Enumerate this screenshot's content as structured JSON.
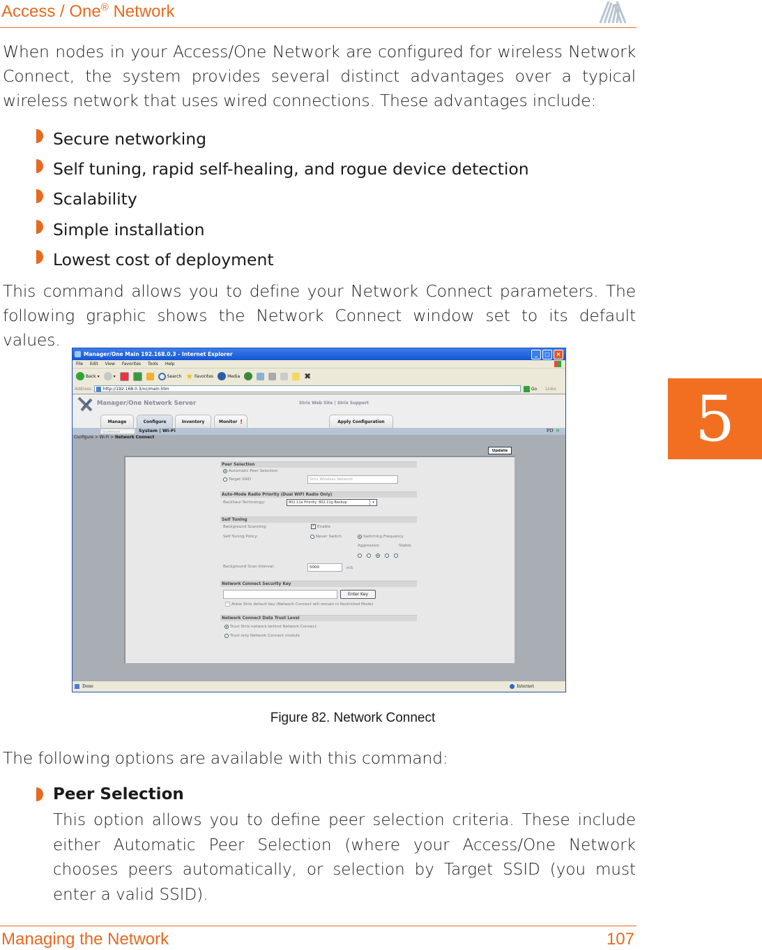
{
  "header": {
    "title": "Access / One",
    "title_sup": "®",
    "title_suffix": " Network"
  },
  "intro_paragraph": "When nodes in your Access/One Network are configured for wireless Network Connect, the system provides several distinct advantages over a typical wireless network that uses wired connections. These advantages include:",
  "advantages": [
    "Secure networking",
    "Self tuning, rapid self-healing, and rogue device detection",
    "Scalability",
    "Simple installation",
    "Lowest cost of deployment"
  ],
  "command_paragraph": "This command allows you to define your Network Connect parameters. The following graphic shows the Network Connect window set to its default values.",
  "chapter_tab": "5",
  "figure": {
    "caption": "Figure 82. Network Connect",
    "window_title": "Manager/One Main 192.168.0.3 - Internet Explorer",
    "menu": [
      "File",
      "Edit",
      "View",
      "Favorites",
      "Tools",
      "Help"
    ],
    "toolbar": {
      "back": "Back",
      "search": "Search",
      "favorites": "Favorites",
      "media": "Media"
    },
    "address_label": "Address",
    "address_url": "http://192.168.0.3/nc/main.htm",
    "go_label": "Go",
    "links_label": "Links",
    "app_title": "Manager/One Network Server",
    "header_links": "Strix Web Site  |  Strix Support",
    "tabs": [
      "Manage",
      "Configure",
      "Inventory",
      "Monitor"
    ],
    "active_tab": "Configure",
    "monitor_alert": "!",
    "apply_tab": "Apply Configuration",
    "network_select": "YourNetwork",
    "subnav": "System  |  Wi-Fi",
    "status_code": "FD",
    "breadcrumb_prefix": "Configure > Wi-Fi > ",
    "breadcrumb_current": "Network Connect",
    "update_button": "Update",
    "peer_selection": {
      "heading": "Peer Selection",
      "auto_label": "Automatic Peer Selection",
      "target_label": "Target SSID",
      "ssid_placeholder": "Strix Wireless Network",
      "selected": "Automatic Peer Selection"
    },
    "radio_priority": {
      "heading": "Auto-Mode Radio Priority (Dual WiFi Radio Only)",
      "label": "Backhaul Technology:",
      "value": "802.11a Priority, 802.11g Backup"
    },
    "self_tuning": {
      "heading": "Self Tuning",
      "scan_label": "Background Scanning:",
      "scan_enable_label": "Enable",
      "scan_enabled": true,
      "policy_label": "Self Tuning Policy:",
      "never_switch": "Never Switch",
      "switching_frequency": "Switching Frequency",
      "policy_selected": "Switching Frequency",
      "aggressive": "Aggressive",
      "stable": "Stable",
      "frequency_levels": 5,
      "frequency_selected_index": 2,
      "interval_label": "Background Scan Interval:",
      "interval_value": "5000",
      "interval_unit": "mS"
    },
    "security_key": {
      "heading": "Network Connect Security Key",
      "key_value": "",
      "enter_key_button": "Enter Key",
      "default_key_label": "Allow Strix default key (Network Connect will remain in Restricted Mode)",
      "default_key_checked": true
    },
    "trust_level": {
      "heading": "Network Connect Data Trust Level",
      "option1": "Trust Strix network behind Network Connect",
      "option2": "Trust only Network Connect module",
      "selected": "Trust Strix network behind Network Connect"
    },
    "status_done": "Done",
    "status_zone": "Internet"
  },
  "options_intro": "The following options are available with this command:",
  "options": [
    {
      "title": "Peer Selection",
      "description": "This option allows you to define peer selection criteria. These include either Automatic Peer Selection (where your Access/One Network chooses peers automatically, or selection by Target SSID (you must enter a valid SSID)."
    }
  ],
  "footer": {
    "section": "Managing the Network",
    "page_number": "107"
  },
  "colors": {
    "accent": "#e8691f",
    "chapter_tab": "#f26f22"
  }
}
